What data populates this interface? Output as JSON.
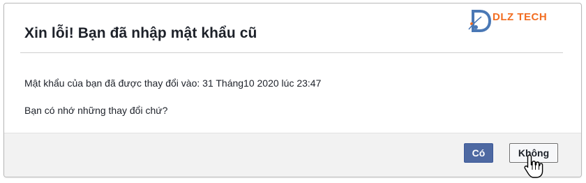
{
  "dialog": {
    "title": "Xin lỗi! Bạn đã nhập mật khẩu cũ",
    "message_line1": "Mật khẩu của bạn đã được thay đổi vào: 31 Tháng10  2020 lúc 23:47",
    "message_line2": "Bạn có nhớ những thay đổi chứ?"
  },
  "buttons": {
    "yes_label": "Có",
    "no_label": "Không"
  },
  "watermark": {
    "brand": "DLZ TECH"
  },
  "colors": {
    "primary_button": "#4e69a2",
    "brand_orange": "#f26d21",
    "brand_blue": "#4a78b5"
  }
}
